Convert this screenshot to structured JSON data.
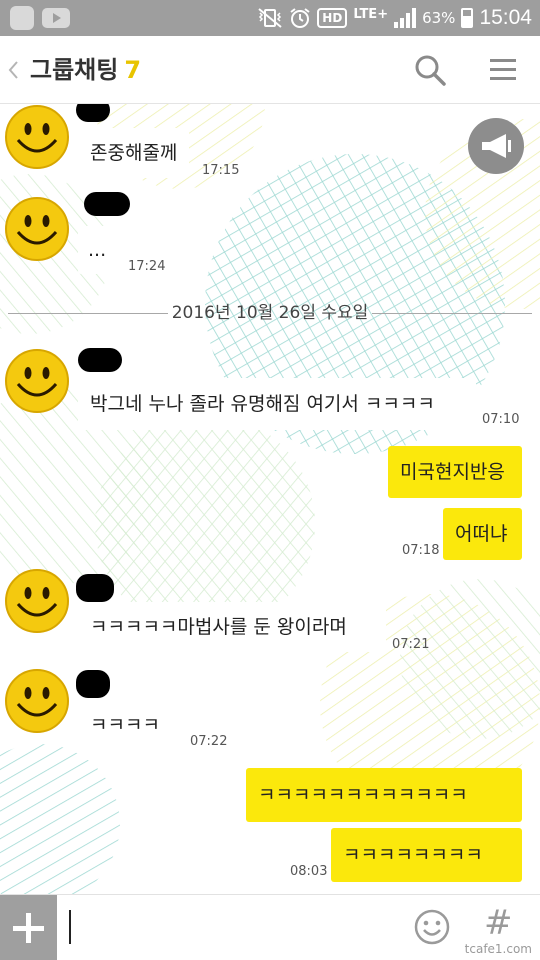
{
  "status_bar": {
    "time": "15:04",
    "battery": "63%",
    "network": "LTE+",
    "hd_label": "HD",
    "icons": [
      "app-icon",
      "youtube-icon",
      "mute-vibrate-icon",
      "alarm-icon",
      "hd-icon",
      "lte-icon",
      "signal-icon",
      "battery-icon"
    ]
  },
  "header": {
    "back_icon": "chevron-left-icon",
    "title": "그룹채팅",
    "member_count": "7",
    "search_icon": "search-icon",
    "menu_icon": "hamburger-menu-icon"
  },
  "chat": {
    "announcement_icon": "megaphone-icon",
    "date_divider": "2016년 10월 26일 수요일",
    "messages": [
      {
        "text": "존중해줄께",
        "time": "17:15",
        "mine": false
      },
      {
        "text": "...",
        "time": "17:24",
        "mine": false
      },
      {
        "text": "박그네 누나 졸라 유명해짐 여기서 ㅋㅋㅋㅋ",
        "time": "07:10",
        "mine": false
      },
      {
        "text": "미국현지반응",
        "time": "",
        "mine": true
      },
      {
        "text": "어떠냐",
        "time": "07:18",
        "mine": true
      },
      {
        "text": "ㅋㅋㅋㅋㅋ마법사를 둔 왕이라며",
        "time": "07:21",
        "mine": false
      },
      {
        "text": "ㅋㅋㅋㅋ",
        "time": "07:22",
        "mine": false
      },
      {
        "text": "ㅋㅋㅋㅋㅋㅋㅋㅋㅋㅋㅋㅋ",
        "time": "",
        "mine": true
      },
      {
        "text": "ㅋㅋㅋㅋㅋㅋㅋㅋ",
        "time": "08:03",
        "mine": true
      }
    ]
  },
  "input_bar": {
    "attach_icon": "plus-icon",
    "message_value": "",
    "emoji_icon": "emoji-icon",
    "hash_icon": "#",
    "watermark": "tcafe1.com"
  },
  "colors": {
    "my_bubble": "#fbe80c",
    "member_count": "#e8c400",
    "status_bar": "#9e9e9e"
  }
}
